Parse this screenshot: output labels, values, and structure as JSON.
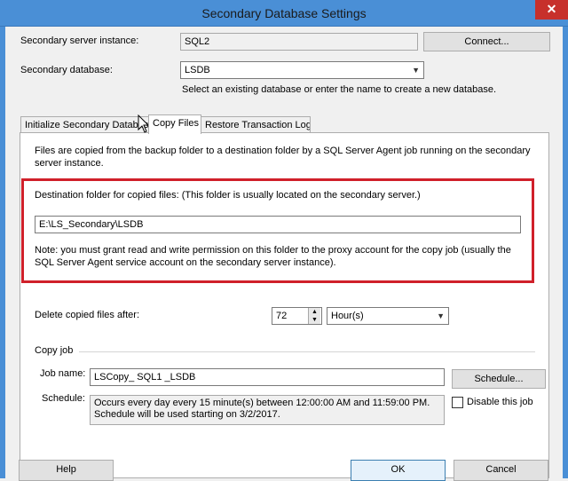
{
  "window": {
    "title": "Secondary Database Settings",
    "close_glyph": "✕"
  },
  "server": {
    "label": "Secondary server instance:",
    "value": "SQL2",
    "connect_button": "Connect..."
  },
  "database": {
    "label": "Secondary database:",
    "value": "LSDB",
    "hint": "Select an existing database or enter the name to create a new database."
  },
  "tabs": [
    {
      "label": "Initialize Secondary Database"
    },
    {
      "label": "Copy Files"
    },
    {
      "label": "Restore Transaction Log"
    }
  ],
  "copy_files": {
    "intro": "Files are copied from the backup folder to a destination folder by a SQL Server Agent job running on the secondary server instance.",
    "dest_label": "Destination folder for copied files: (This folder is usually located on the secondary server.)",
    "dest_value": "E:\\LS_Secondary\\LSDB",
    "note": "Note: you must grant read and write permission on this folder to the proxy account for the copy job (usually the SQL Server Agent service account on the secondary server instance).",
    "delete_label": "Delete copied files after:",
    "delete_value": "72",
    "delete_unit": "Hour(s)"
  },
  "copy_job": {
    "group_label": "Copy job",
    "job_name_label": "Job name:",
    "job_name_value": "LSCopy_ SQL1 _LSDB",
    "schedule_button": "Schedule...",
    "schedule_label": "Schedule:",
    "schedule_text": "Occurs every day every 15 minute(s) between 12:00:00 AM and 11:59:00 PM. Schedule will be used starting on 3/2/2017.",
    "disable_label": "Disable this job"
  },
  "footer": {
    "help": "Help",
    "ok": "OK",
    "cancel": "Cancel"
  }
}
